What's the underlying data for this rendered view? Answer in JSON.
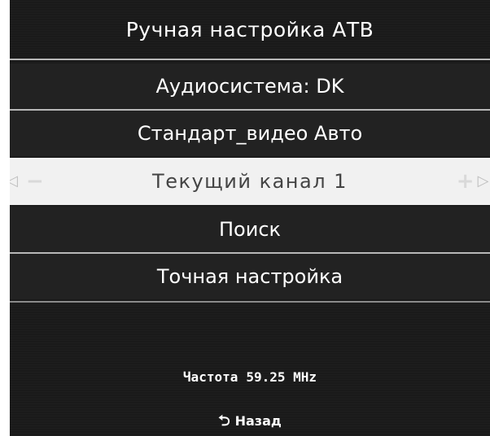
{
  "menu": {
    "title": "Ручная настройка АТВ",
    "items": [
      {
        "label": "Аудиосистема: DK"
      },
      {
        "label": "Стандарт_видео Авто"
      },
      {
        "label": "Текущий канал 1",
        "selected": true
      },
      {
        "label": "Поиск"
      },
      {
        "label": "Точная настройка"
      }
    ],
    "selected_item": {
      "left_arrow_icon": "left-arrow-icon",
      "right_arrow_icon": "right-arrow-icon",
      "minus_icon": "minus-icon",
      "plus_icon": "plus-icon"
    }
  },
  "status": {
    "frequency_label": "Частота",
    "frequency_value": "59.25 MHz"
  },
  "footer": {
    "back_icon": "return-arrow-icon",
    "back_label": "Назад"
  },
  "colors": {
    "background": "#1a1a1a",
    "selected_background": "#f1f1f1",
    "selected_text": "#444444",
    "text": "#ffffff"
  }
}
